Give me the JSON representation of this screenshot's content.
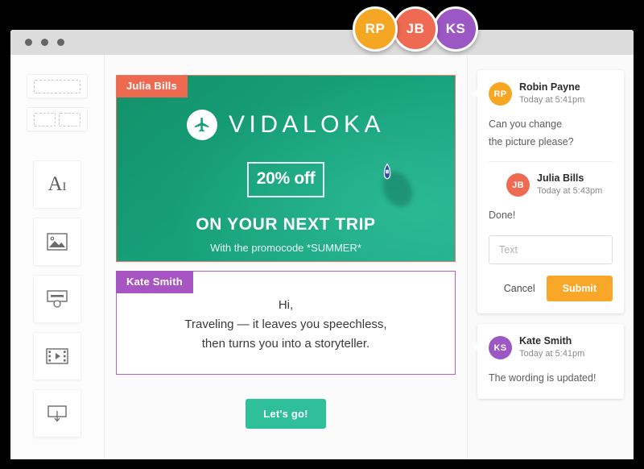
{
  "colors": {
    "orange": "#f5a623",
    "salmon": "#ee6a52",
    "purple": "#9b57c3",
    "green": "#17a07a",
    "cta_green": "#2fbf9a",
    "submit_orange": "#f9a728"
  },
  "avatars_bar": [
    {
      "initials": "RP",
      "color": "#f5a623",
      "name": "avatar-rp"
    },
    {
      "initials": "JB",
      "color": "#ee6a52",
      "name": "avatar-jb"
    },
    {
      "initials": "KS",
      "color": "#9b57c3",
      "name": "avatar-ks"
    }
  ],
  "sidebar": {
    "layout_presets": [
      {
        "name": "layout-one-column"
      },
      {
        "name": "layout-two-columns"
      }
    ],
    "tools": [
      {
        "name": "text-tool",
        "icon": "text-icon",
        "glyph": "A"
      },
      {
        "name": "image-tool",
        "icon": "image-icon"
      },
      {
        "name": "button-tool",
        "icon": "button-icon"
      },
      {
        "name": "video-tool",
        "icon": "video-icon"
      },
      {
        "name": "form-tool",
        "icon": "form-icon"
      }
    ]
  },
  "canvas": {
    "hero": {
      "owner_badge": "Julia Bills",
      "brand_icon": "airplane-icon",
      "brand_name": "VIDALOKA",
      "offer": "20% off",
      "headline": "ON YOUR NEXT TRIP",
      "subline": "With the promocode *SUMMER*"
    },
    "text_block": {
      "owner_badge": "Kate Smith",
      "lines": [
        "Hi,",
        "Traveling — it leaves you speechless,",
        "then turns you into a storyteller."
      ]
    },
    "cta": {
      "label": "Let's go!"
    }
  },
  "comments": [
    {
      "id": "thread-1",
      "messages": [
        {
          "initials": "RP",
          "color": "#f5a623",
          "author": "Robin Payne",
          "time": "Today at 5:41pm",
          "text": "Can you change\nthe picture please?",
          "indent": false
        },
        {
          "initials": "JB",
          "color": "#ee6a52",
          "author": "Julia Bills",
          "time": "Today at 5:43pm",
          "text": "Done!",
          "indent": true
        }
      ],
      "reply": {
        "value": "",
        "placeholder": "Text",
        "cancel_label": "Cancel",
        "submit_label": "Submit"
      }
    },
    {
      "id": "thread-2",
      "messages": [
        {
          "initials": "KS",
          "color": "#9b57c3",
          "author": "Kate Smith",
          "time": "Today at 5:41pm",
          "text": "The wording is updated!",
          "indent": false
        }
      ]
    }
  ]
}
